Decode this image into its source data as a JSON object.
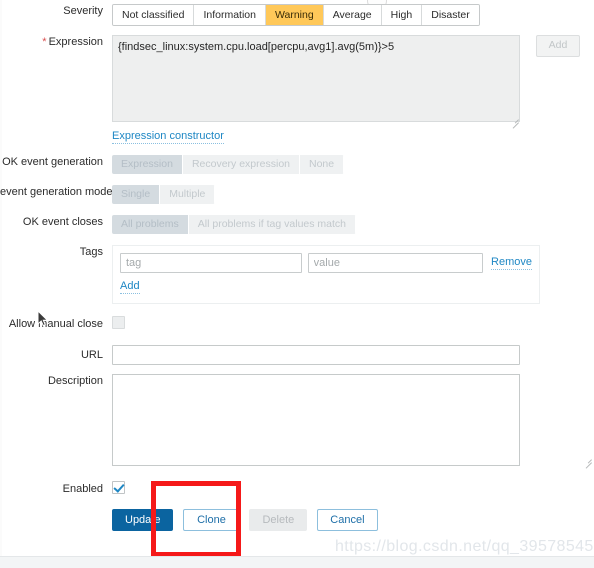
{
  "form": {
    "severity": {
      "label": "Severity",
      "options": [
        "Not classified",
        "Information",
        "Warning",
        "Average",
        "High",
        "Disaster"
      ],
      "selected": "Warning",
      "selected_color": "#ffc859"
    },
    "expression": {
      "label": "Expression",
      "required_marker": "*",
      "value": "{findsec_linux:system.cpu.load[percpu,avg1].avg(5m)}>5",
      "add_button": "Add",
      "constructor_link": "Expression constructor"
    },
    "ok_event_generation": {
      "label": "OK event generation",
      "options": [
        "Expression",
        "Recovery expression",
        "None"
      ],
      "selected": "Expression"
    },
    "problem_event_generation_mode": {
      "label": "event generation mode",
      "options": [
        "Single",
        "Multiple"
      ],
      "selected": "Single"
    },
    "ok_event_closes": {
      "label": "OK event closes",
      "options": [
        "All problems",
        "All problems if tag values match"
      ],
      "selected": "All problems"
    },
    "tags": {
      "label": "Tags",
      "tag_placeholder": "tag",
      "tag_value": "",
      "value_placeholder": "value",
      "value_value": "",
      "remove_label": "Remove",
      "add_label": "Add"
    },
    "allow_manual_close": {
      "label": "Allow manual close",
      "checked": false
    },
    "url": {
      "label": "URL",
      "value": "",
      "placeholder": ""
    },
    "description": {
      "label": "Description",
      "value": "",
      "placeholder": ""
    },
    "enabled": {
      "label": "Enabled",
      "checked": true
    }
  },
  "footer": {
    "update_label": "Update",
    "clone_label": "Clone",
    "delete_label": "Delete",
    "cancel_label": "Cancel"
  },
  "annotation": {
    "highlight_color": "#f51919"
  },
  "watermark": {
    "text": "https://blog.csdn.net/qq_39578545"
  }
}
